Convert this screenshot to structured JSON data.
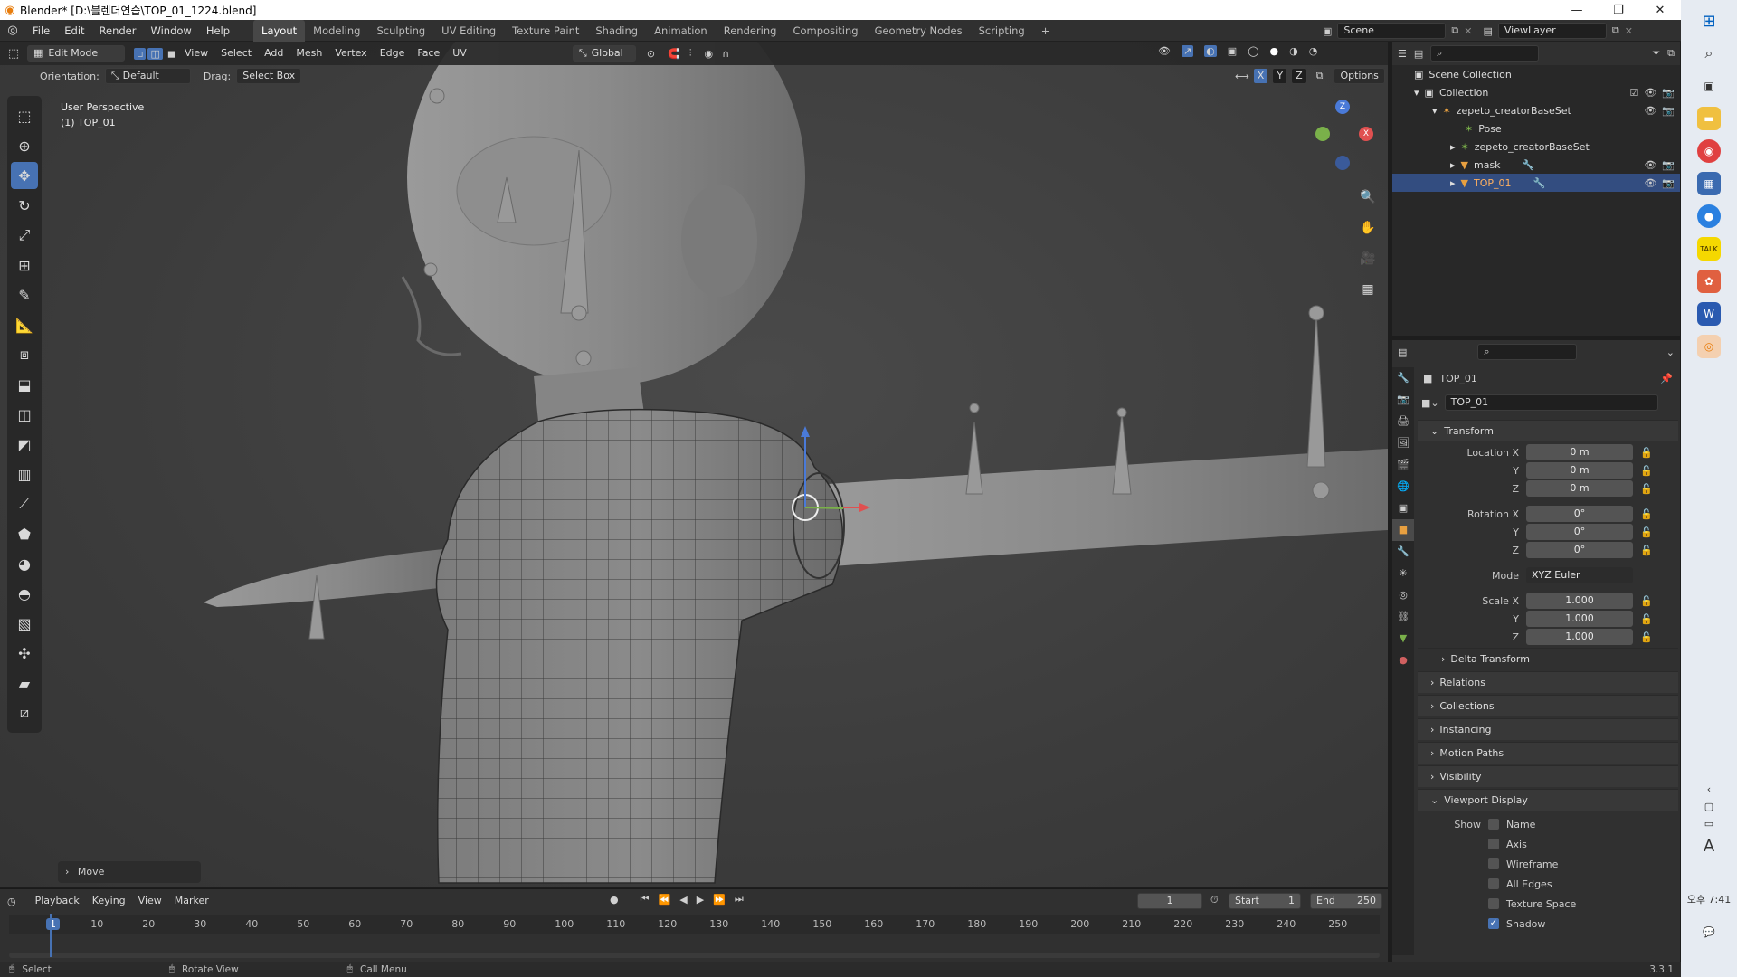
{
  "window": {
    "title": "Blender* [D:\\블렌더연습\\TOP_01_1224.blend]"
  },
  "menu": [
    "File",
    "Edit",
    "Render",
    "Window",
    "Help"
  ],
  "workspaces": [
    "Layout",
    "Modeling",
    "Sculpting",
    "UV Editing",
    "Texture Paint",
    "Shading",
    "Animation",
    "Rendering",
    "Compositing",
    "Geometry Nodes",
    "Scripting"
  ],
  "workspace_add": "+",
  "scene": {
    "label": "Scene",
    "viewlayer": "ViewLayer"
  },
  "viewport_header": {
    "mode": "Edit Mode",
    "menus": [
      "View",
      "Select",
      "Add",
      "Mesh",
      "Vertex",
      "Edge",
      "Face",
      "UV"
    ],
    "transform": "Global"
  },
  "tool_header": {
    "orientation_label": "Orientation:",
    "orientation": "Default",
    "drag_label": "Drag:",
    "drag": "Select Box",
    "axes": [
      "X",
      "Y",
      "Z"
    ],
    "options": "Options"
  },
  "viewport": {
    "line1": "User Perspective",
    "line2": "(1) TOP_01",
    "last_op": "Move"
  },
  "gizmo_axes": {
    "z": "Z",
    "x": "X"
  },
  "outliner": {
    "search_placeholder": "",
    "root": "Scene Collection",
    "items": [
      {
        "name": "Collection",
        "level": 1
      },
      {
        "name": "zepeto_creatorBaseSet",
        "level": 2
      },
      {
        "name": "Pose",
        "level": 3
      },
      {
        "name": "zepeto_creatorBaseSet",
        "level": 3
      },
      {
        "name": "mask",
        "level": 3
      },
      {
        "name": "TOP_01",
        "level": 3,
        "selected": true
      }
    ]
  },
  "properties": {
    "object_name": "TOP_01",
    "data_name": "TOP_01",
    "transform_title": "Transform",
    "location": {
      "label": "Location X",
      "x": "0 m",
      "y": "0 m",
      "z": "0 m"
    },
    "rotation": {
      "label": "Rotation X",
      "x": "0°",
      "y": "0°",
      "z": "0°"
    },
    "mode_label": "Mode",
    "mode_value": "XYZ Euler",
    "scale": {
      "label": "Scale X",
      "x": "1.000",
      "y": "1.000",
      "z": "1.000"
    },
    "axis_y": "Y",
    "axis_z": "Z",
    "delta": "Delta Transform",
    "panels": [
      "Relations",
      "Collections",
      "Instancing",
      "Motion Paths",
      "Visibility"
    ],
    "viewport_display": "Viewport Display",
    "show_label": "Show",
    "show_items": [
      {
        "label": "Name",
        "checked": false
      },
      {
        "label": "Axis",
        "checked": false
      },
      {
        "label": "Wireframe",
        "checked": false
      },
      {
        "label": "All Edges",
        "checked": false
      },
      {
        "label": "Texture Space",
        "checked": false
      },
      {
        "label": "Shadow",
        "checked": true
      }
    ]
  },
  "timeline": {
    "menus": [
      "Playback",
      "Keying",
      "View",
      "Marker"
    ],
    "current_frame": "1",
    "start_label": "Start",
    "start": "1",
    "end_label": "End",
    "end": "250",
    "ticks": [
      "1",
      "10",
      "20",
      "30",
      "40",
      "50",
      "60",
      "70",
      "80",
      "90",
      "100",
      "110",
      "120",
      "130",
      "140",
      "150",
      "160",
      "170",
      "180",
      "190",
      "200",
      "210",
      "220",
      "230",
      "240",
      "250"
    ]
  },
  "statusbar": {
    "select": "Select",
    "rotate": "Rotate View",
    "menu": "Call Menu",
    "version": "3.3.1"
  },
  "taskbar": {
    "lang": "A",
    "time": "오후 7:41"
  },
  "colors": {
    "accent": "#4772b3",
    "selected_row": "#334d80",
    "x_axis": "#e05050",
    "y_axis": "#7ab04a",
    "z_axis": "#4a7ad8"
  }
}
